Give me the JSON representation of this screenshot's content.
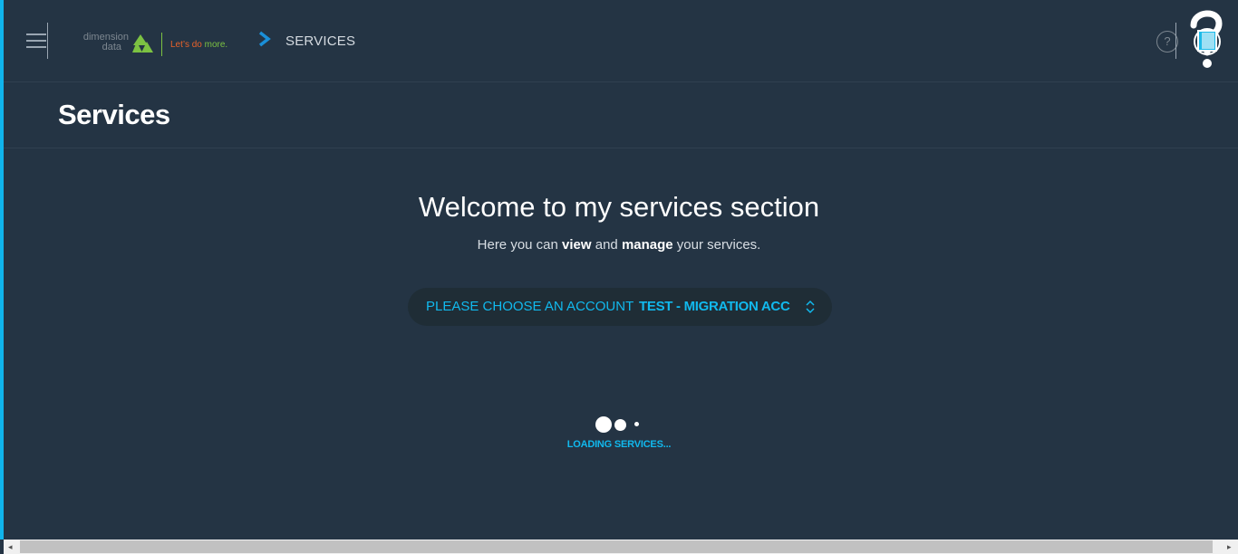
{
  "logo": {
    "line1": "dimension",
    "line2": "data",
    "slogan_a": "Let’s do ",
    "slogan_b": "more."
  },
  "breadcrumb": {
    "current": "SERVICES"
  },
  "header": {
    "title": "Services"
  },
  "main": {
    "welcome": "Welcome to my services section",
    "subtitle_pre": "Here you can ",
    "subtitle_view": "view",
    "subtitle_mid": " and ",
    "subtitle_manage": "manage",
    "subtitle_post": " your services."
  },
  "account": {
    "label": "PLEASE CHOOSE AN ACCOUNT",
    "selected": "TEST - MIGRATION ACC"
  },
  "loader": {
    "text": "LOADING SERVICES..."
  },
  "icons": {
    "menu": "hamburger-icon",
    "breadcrumb": "chevron-right-icon",
    "help": "help-icon",
    "select": "up-down-chevron-icon"
  },
  "colors": {
    "background": "#243444",
    "accent": "#11b9ee",
    "edge": "#10b4ec"
  }
}
